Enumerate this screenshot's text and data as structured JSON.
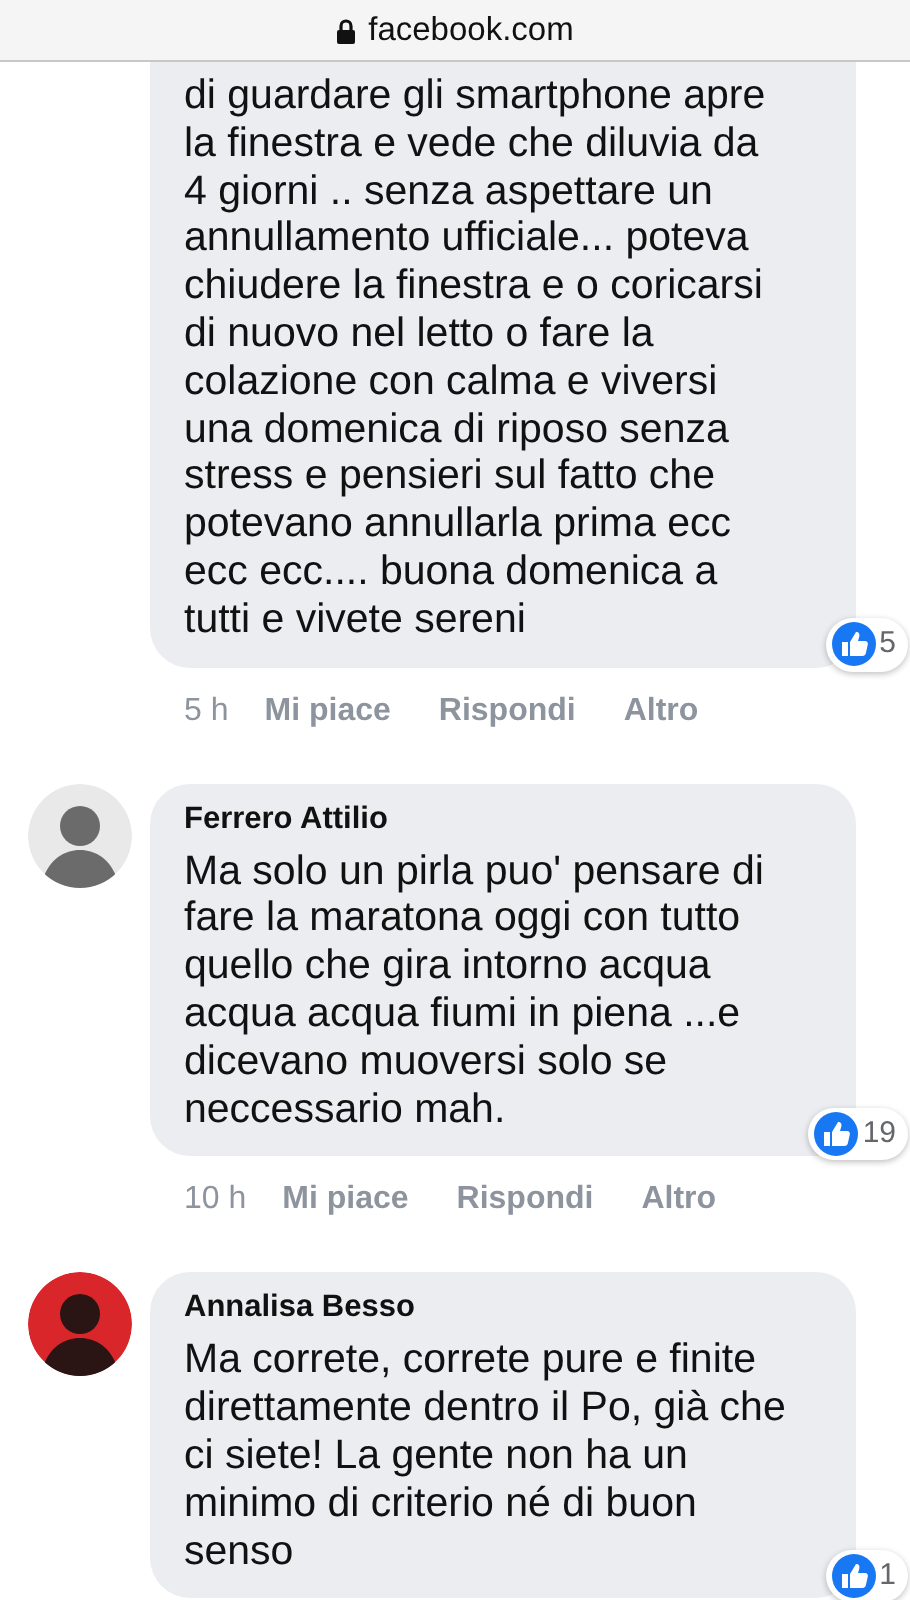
{
  "address_bar": {
    "domain": "facebook.com"
  },
  "comments": [
    {
      "lines": [
        "di guardare gli smartphone apre",
        "la finestra e vede che diluvia da",
        "4 giorni .. senza aspettare un",
        "annullamento ufficiale... poteva",
        "chiudere la finestra e o coricarsi",
        "di nuovo nel letto o fare la",
        "colazione con calma e viversi",
        "una domenica di riposo senza",
        "stress e pensieri sul fatto che",
        "potevano annullarla prima ecc",
        "ecc ecc.... buona domenica a",
        "tutti e vivete sereni"
      ],
      "reactions": "5",
      "time": "5 h",
      "actions": [
        "Mi piace",
        "Rispondi",
        "Altro"
      ]
    },
    {
      "author": "Ferrero Attilio",
      "avatar": {
        "kind": "picture"
      },
      "lines": [
        "Ma solo un pirla puo' pensare di",
        "fare la maratona oggi con tutto",
        "quello che gira intorno acqua",
        "acqua acqua fiumi in piena ...e",
        "dicevano muoversi solo se",
        "neccessario mah."
      ],
      "reactions": "19",
      "time": "10 h",
      "actions": [
        "Mi piace",
        "Rispondi",
        "Altro"
      ]
    },
    {
      "author": "Annalisa Besso",
      "avatar": {
        "kind": "picture"
      },
      "lines": [
        "Ma correte, correte pure e finite",
        "direttamente dentro il Po, già che",
        "ci siete! La gente non ha un",
        "minimo di criterio né di buon",
        "senso"
      ],
      "reactions": "1"
    }
  ]
}
